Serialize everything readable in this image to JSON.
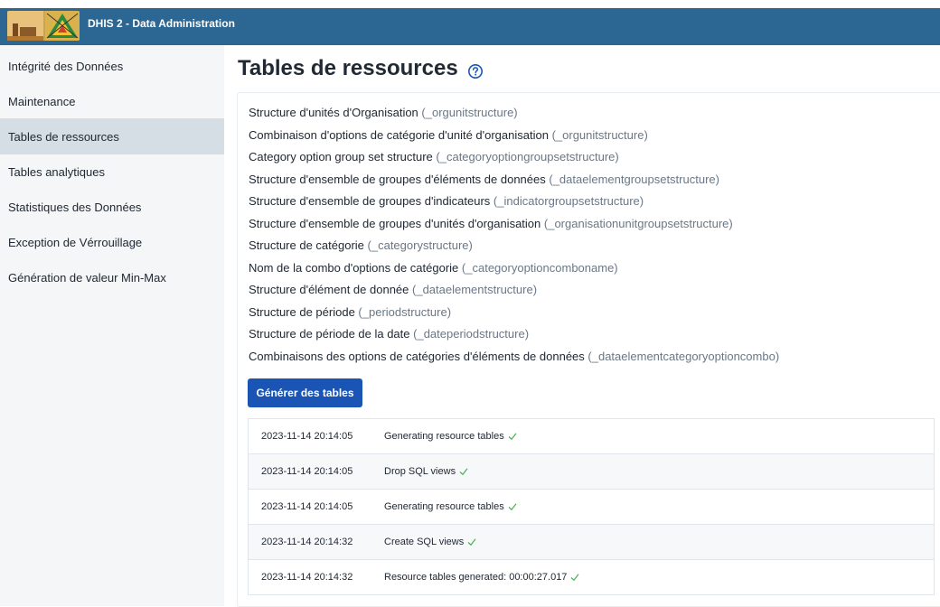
{
  "app": {
    "title": "DHIS 2 - Data Administration"
  },
  "sidebar": {
    "items": [
      {
        "label": "Intégrité des Données"
      },
      {
        "label": "Maintenance"
      },
      {
        "label": "Tables de ressources"
      },
      {
        "label": "Tables analytiques"
      },
      {
        "label": "Statistiques des Données"
      },
      {
        "label": "Exception de Vérrouillage"
      },
      {
        "label": "Génération de valeur Min-Max"
      }
    ],
    "active": "Tables de ressources"
  },
  "page": {
    "title": "Tables de ressources"
  },
  "tables": [
    {
      "name": "Structure d'unités d'Organisation",
      "code": "(_orgunitstructure)"
    },
    {
      "name": "Combinaison d'options de catégorie d'unité d'organisation",
      "code": "(_orgunitstructure)"
    },
    {
      "name": "Category option group set structure",
      "code": "(_categoryoptiongroupsetstructure)"
    },
    {
      "name": "Structure d'ensemble de groupes d'éléments de données",
      "code": "(_dataelementgroupsetstructure)"
    },
    {
      "name": "Structure d'ensemble de groupes d'indicateurs",
      "code": "(_indicatorgroupsetstructure)"
    },
    {
      "name": "Structure d'ensemble de groupes d'unités d'organisation",
      "code": "(_organisationunitgroupsetstructure)"
    },
    {
      "name": "Structure de catégorie",
      "code": "(_categorystructure)"
    },
    {
      "name": "Nom de la combo d'options de catégorie",
      "code": "(_categoryoptioncomboname)"
    },
    {
      "name": "Structure d'élément de donnée",
      "code": "(_dataelementstructure)"
    },
    {
      "name": "Structure de période",
      "code": "(_periodstructure)"
    },
    {
      "name": "Structure de période de la date",
      "code": "(_dateperiodstructure)"
    },
    {
      "name": "Combinaisons des options de catégories d'éléments de données",
      "code": "(_dataelementcategoryoptioncombo)"
    }
  ],
  "actions": {
    "generate_label": "Générer des tables"
  },
  "log": [
    {
      "time": "2023-11-14 20:14:05",
      "message": "Generating resource tables"
    },
    {
      "time": "2023-11-14 20:14:05",
      "message": "Drop SQL views"
    },
    {
      "time": "2023-11-14 20:14:05",
      "message": "Generating resource tables"
    },
    {
      "time": "2023-11-14 20:14:32",
      "message": "Create SQL views"
    },
    {
      "time": "2023-11-14 20:14:32",
      "message": "Resource tables generated: 00:00:27.017"
    }
  ],
  "icons": {
    "help": "help-circle-icon",
    "check": "check-icon",
    "logo": "app-logo"
  },
  "colors": {
    "header": "#2c6693",
    "primary_button": "#1a55b5",
    "check": "#4caf50",
    "active_nav": "#d5dde5"
  }
}
